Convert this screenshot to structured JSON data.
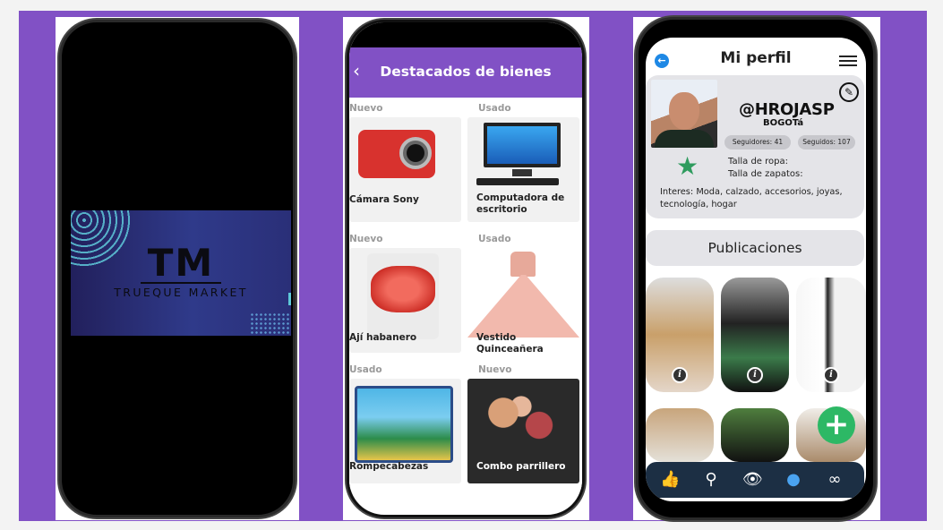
{
  "splash": {
    "logo_letters": "TM",
    "logo_subtitle": "TRUEQUE MARKET"
  },
  "featured": {
    "title": "Destacados de bienes",
    "back_icon": "chevron-left-icon",
    "items": [
      {
        "condition": "Nuevo",
        "name": "Cámara Sony"
      },
      {
        "condition": "Usado",
        "name": "Computadora de escritorio"
      },
      {
        "condition": "Nuevo",
        "name": "Ají habanero"
      },
      {
        "condition": "Usado",
        "name": "Vestido Quinceañera"
      },
      {
        "condition": "Usado",
        "name": "Rompecabezas"
      },
      {
        "condition": "Nuevo",
        "name": "Combo parrillero"
      }
    ]
  },
  "profile": {
    "title": "Mi perfil",
    "handle": "@HROJASP",
    "city": "BOGOTá",
    "followers": "Seguidores: 41",
    "following": "Seguidos: 107",
    "clothing_size": "Talla de ropa:",
    "shoe_size": "Talla de zapatos:",
    "interests": "Interes: Moda, calzado, accesorios, joyas, tecnología, hogar",
    "publications_label": "Publicaciones",
    "fab_label": "+",
    "nav": [
      "like-icon",
      "search-icon",
      "eye-icon",
      "user-icon",
      "link-icon"
    ]
  },
  "colors": {
    "brand_purple": "#8151c5",
    "fab_green": "#2db865",
    "nav_dark": "#1c2f44"
  }
}
